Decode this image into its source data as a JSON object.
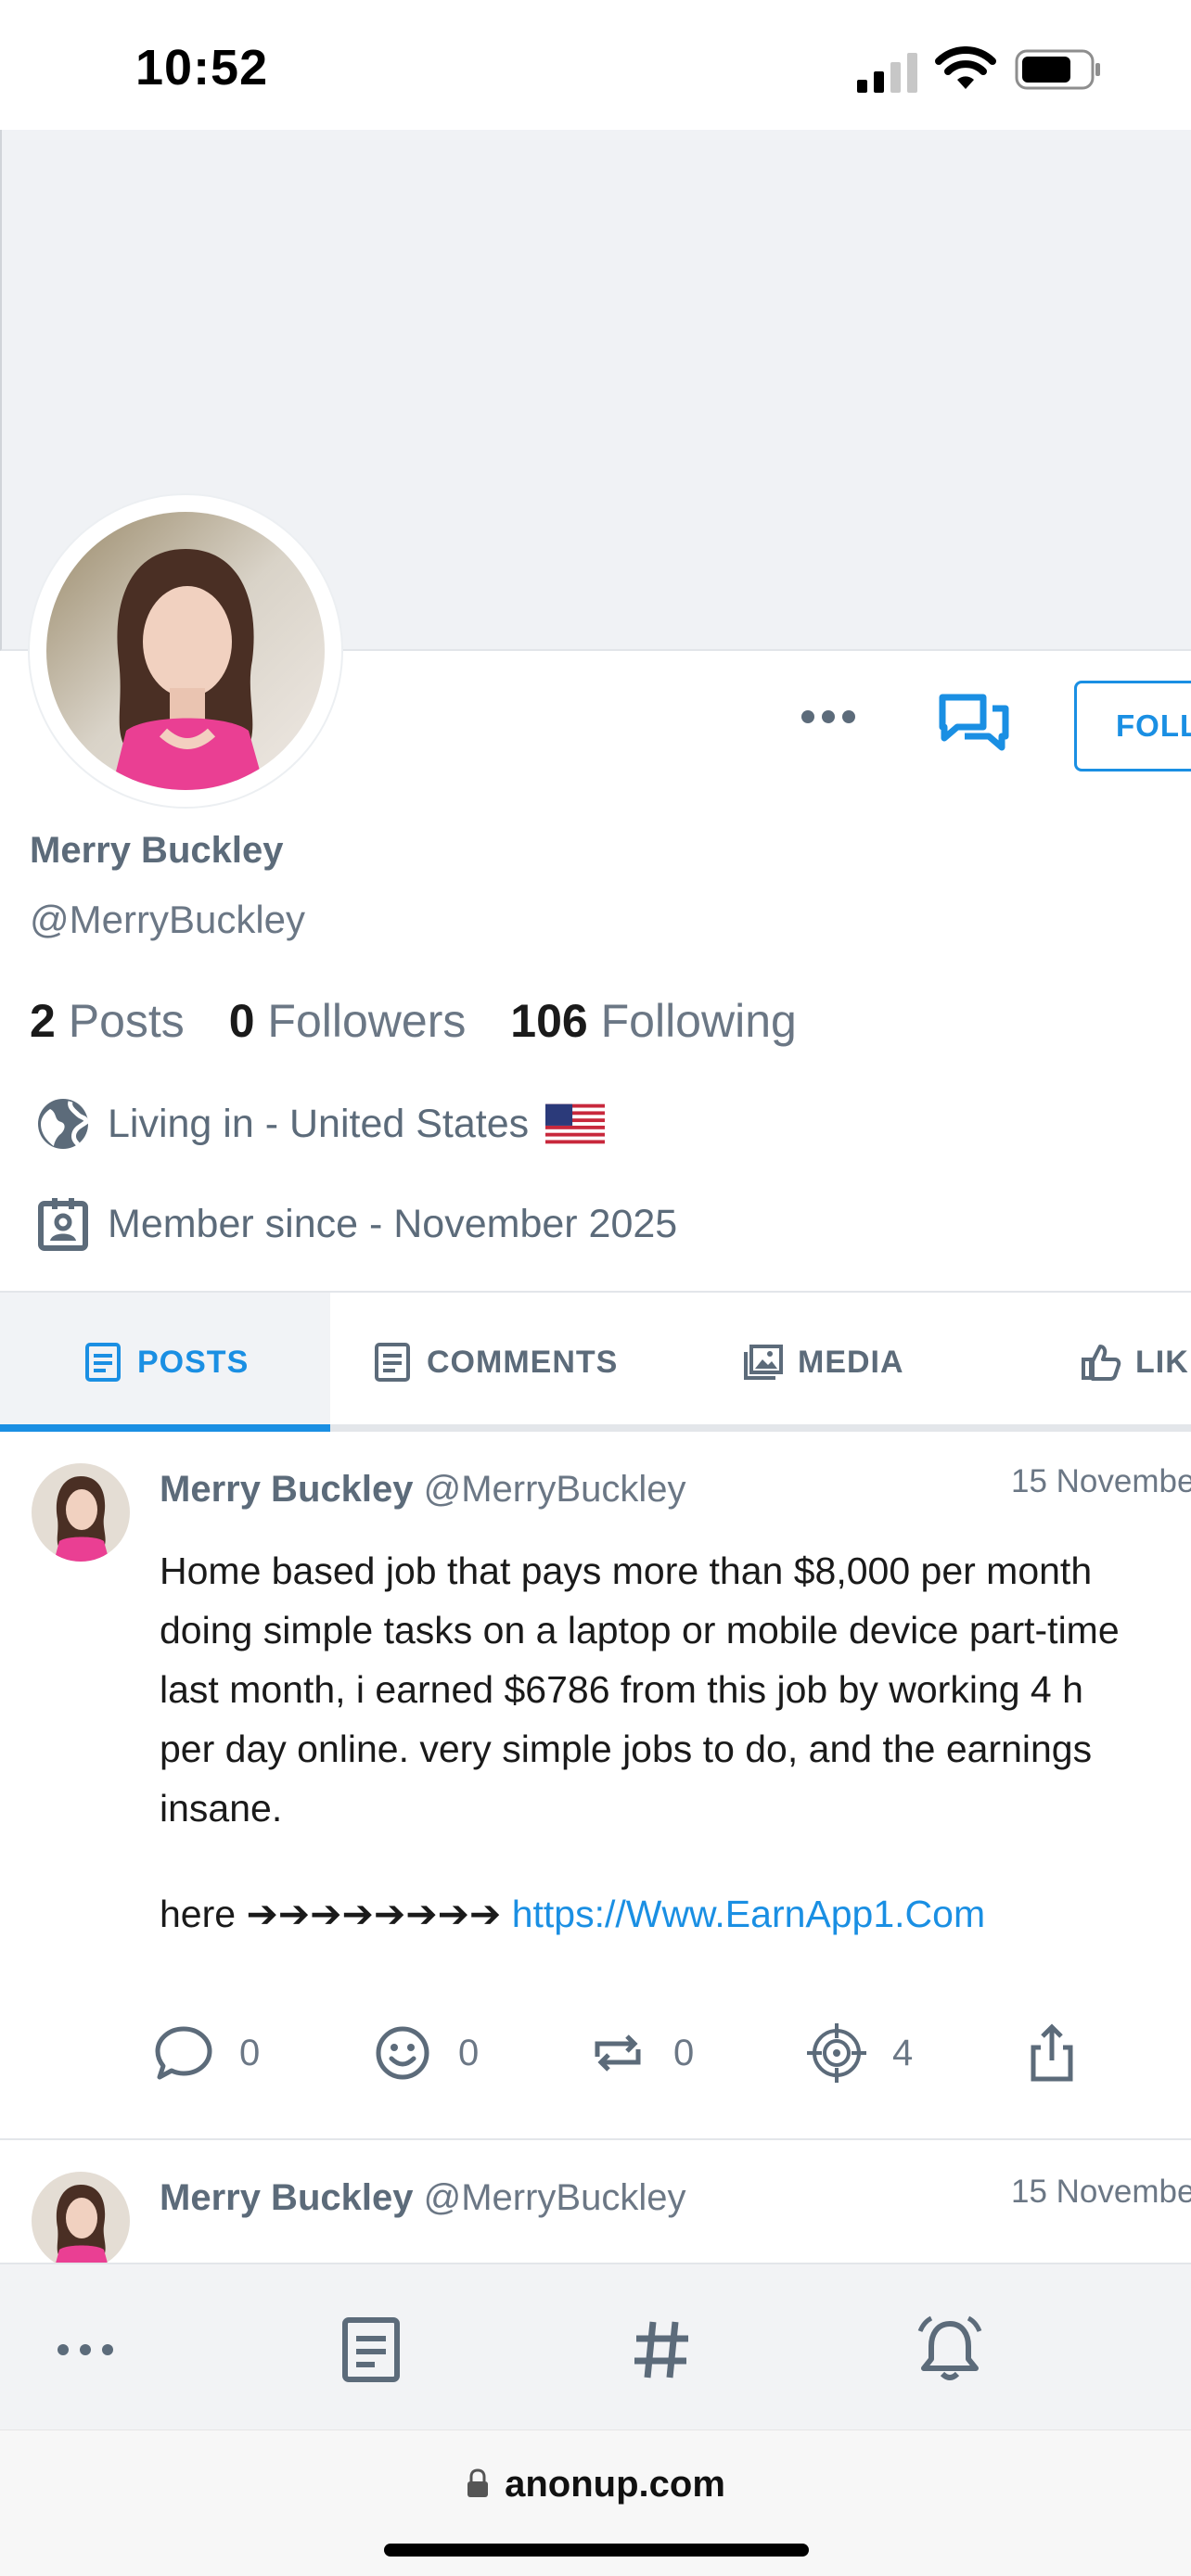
{
  "status_bar": {
    "time": "10:52"
  },
  "profile": {
    "name": "Merry Buckley",
    "handle": "@MerryBuckley",
    "follow_label": "FOLL",
    "stats": {
      "posts_count": "2",
      "posts_label": "Posts",
      "followers_count": "0",
      "followers_label": "Followers",
      "following_count": "106",
      "following_label": "Following"
    },
    "location": "Living in - United States",
    "member_since": "Member since - November 2025"
  },
  "tabs": [
    {
      "label": "POSTS",
      "active": true
    },
    {
      "label": "COMMENTS",
      "active": false
    },
    {
      "label": "MEDIA",
      "active": false
    },
    {
      "label": "LIK",
      "active": false
    }
  ],
  "posts": [
    {
      "author": "Merry Buckley",
      "handle": "@MerryBuckley",
      "date": "15 Novembe",
      "lines": [
        "Home based job that pays more than $8,000 per month",
        "doing simple tasks on a laptop or mobile device part-time",
        "last month, i earned $6786 from this job by working 4 h",
        "per day online. very simple jobs to do, and the earnings",
        "insane."
      ],
      "link_prefix": "here ➔➔➔➔➔➔➔➔",
      "link": "https://Www.EarnApp1.Com",
      "counts": {
        "replies": "0",
        "reactions": "0",
        "reposts": "0",
        "targets": "4"
      }
    },
    {
      "author": "Merry Buckley",
      "handle": "@MerryBuckley",
      "date": "15 Novembe"
    }
  ],
  "browser": {
    "url": "anonup.com"
  },
  "colors": {
    "accent": "#1a8fe3",
    "muted_text": "#6b7785",
    "cover": "#f0f2f5"
  },
  "icons": [
    "signal-icon",
    "wifi-icon",
    "battery-icon",
    "more-icon",
    "chat-icon",
    "globe-icon",
    "member-card-icon",
    "flag-icon",
    "document-icon",
    "image-icon",
    "thumbs-up-icon",
    "reply-icon",
    "smiley-icon",
    "repost-icon",
    "target-icon",
    "share-icon",
    "hashtag-icon",
    "bell-icon",
    "lock-icon"
  ]
}
